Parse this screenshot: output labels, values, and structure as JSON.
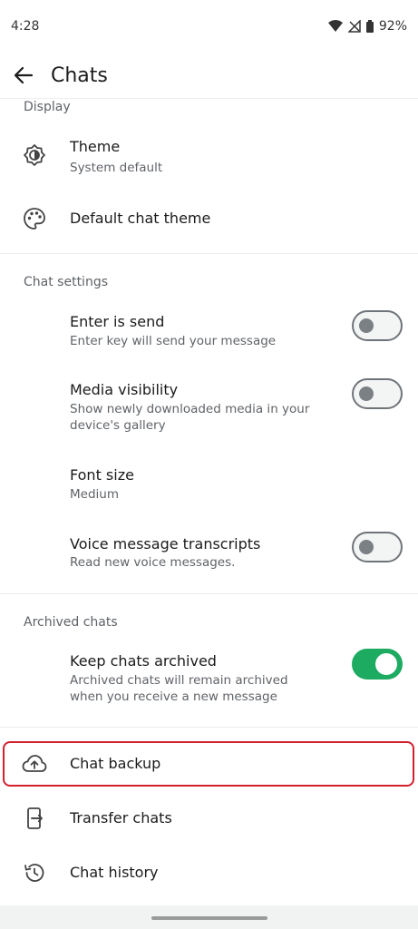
{
  "status": {
    "time": "4:28",
    "battery": "92%"
  },
  "header": {
    "title": "Chats"
  },
  "display": {
    "header": "Display",
    "theme_title": "Theme",
    "theme_sub": "System default",
    "default_chat_theme": "Default chat theme"
  },
  "chat_settings": {
    "header": "Chat settings",
    "enter_send_title": "Enter is send",
    "enter_send_sub": "Enter key will send your message",
    "enter_send_on": false,
    "media_title": "Media visibility",
    "media_sub_1": "Show newly downloaded media in your",
    "media_sub_2": "device's gallery",
    "media_on": false,
    "font_title": "Font size",
    "font_sub": "Medium",
    "voice_title": "Voice message transcripts",
    "voice_sub": "Read new voice messages.",
    "voice_on": false
  },
  "archived": {
    "header": "Archived chats",
    "keep_title": "Keep chats archived",
    "keep_sub_1": "Archived chats will remain archived",
    "keep_sub_2": "when you receive a new message",
    "keep_on": true
  },
  "more": {
    "backup": "Chat backup",
    "transfer": "Transfer chats",
    "history": "Chat history"
  },
  "colors": {
    "accent": "#1daa61",
    "highlight": "#d2202f"
  }
}
